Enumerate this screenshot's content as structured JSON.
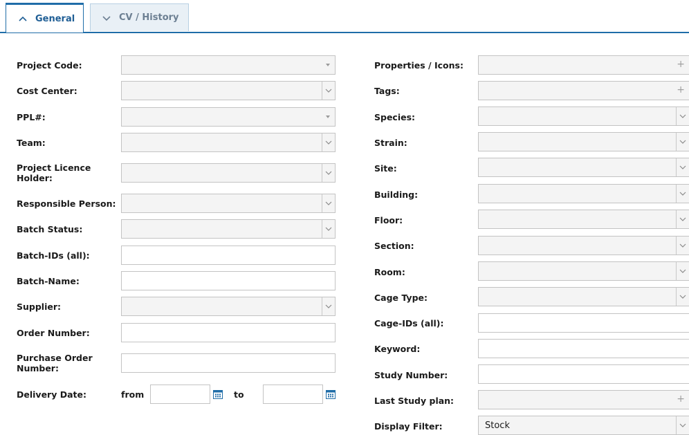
{
  "tabs": [
    {
      "label": "General",
      "active": true
    },
    {
      "label": "CV / History",
      "active": false
    }
  ],
  "left": {
    "project_code": "Project Code:",
    "cost_center": "Cost Center:",
    "ppl": "PPL#:",
    "team": "Team:",
    "project_licence_holder_1": "Project Licence",
    "project_licence_holder_2": "Holder:",
    "responsible_person": "Responsible Person:",
    "batch_status": "Batch Status:",
    "batch_ids": "Batch-IDs (all):",
    "batch_name": "Batch-Name:",
    "supplier": "Supplier:",
    "order_number": "Order Number:",
    "purchase_order_number_1": "Purchase Order",
    "purchase_order_number_2": "Number:",
    "delivery_date": "Delivery Date:",
    "from": "from",
    "to": "to"
  },
  "right": {
    "properties_icons": "Properties / Icons:",
    "tags": "Tags:",
    "species": "Species:",
    "strain": "Strain:",
    "site": "Site:",
    "building": "Building:",
    "floor": "Floor:",
    "section": "Section:",
    "room": "Room:",
    "cage_type": "Cage Type:",
    "cage_ids": "Cage-IDs (all):",
    "keyword": "Keyword:",
    "study_number": "Study Number:",
    "last_study_plan": "Last Study plan:",
    "display_filter": "Display Filter:",
    "display_filter_value": "Stock"
  },
  "icons": {
    "tab_active": "chevron-up-icon",
    "tab_inactive": "chevron-down-icon",
    "calendar": "calendar-icon",
    "add": "plus-icon"
  },
  "colors": {
    "accent": "#1f6da8",
    "active_tab_text": "#1f5e95",
    "inactive_tab_bg": "#e9f0f6"
  }
}
